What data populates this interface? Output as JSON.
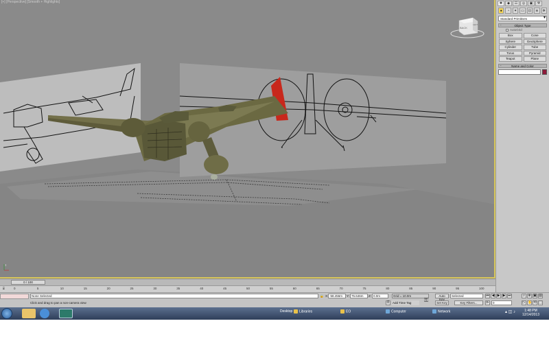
{
  "viewport": {
    "label": "[+] [Perspective] [Smooth + Highlights]",
    "viewcube_front": "BACK",
    "viewcube_side": "LEFT",
    "axis_label": "x"
  },
  "command_panel": {
    "tabs": [
      "create",
      "modify",
      "hierarchy",
      "motion",
      "display",
      "utilities"
    ],
    "category_icons": [
      "geometry",
      "shapes",
      "lights",
      "cameras",
      "helpers",
      "space-warps",
      "systems"
    ],
    "primitive_type": "Standard Primitives",
    "object_type_header": "Object Type",
    "autogrid_label": "AutoGrid",
    "buttons": [
      "Box",
      "Cone",
      "Sphere",
      "GeoSphere",
      "Cylinder",
      "Tube",
      "Torus",
      "Pyramid",
      "Teapot",
      "Plane"
    ],
    "name_color_header": "Name and Color",
    "name_value": "",
    "color": "#8e1a3a"
  },
  "timeline": {
    "slider_label": "0 / 100",
    "ticks": [
      "0",
      "5",
      "10",
      "15",
      "20",
      "25",
      "30",
      "35",
      "40",
      "45",
      "50",
      "55",
      "60",
      "65",
      "70",
      "75",
      "80",
      "85",
      "90",
      "95",
      "100"
    ]
  },
  "status": {
    "selection": "None Selected",
    "prompt": "Click and drag to pan a non-camera view",
    "x_label": "X:",
    "x_value": "-58.456m",
    "y_label": "Y:",
    "y_value": "75.646m",
    "z_label": "Z:",
    "z_value": "0.0m",
    "grid": "Grid = 10.0m",
    "add_time_tag": "Add Time Tag",
    "auto_key": "Auto Key",
    "set_key": "Set Key",
    "selected_dropdown": "Selected",
    "key_filters": "Key Filters...",
    "frame": "0"
  },
  "taskbar": {
    "desktop_label": "Desktop",
    "items": [
      {
        "label": "Libraries",
        "color": "#e8c14a"
      },
      {
        "label": "EO",
        "color": "#e8c14a"
      },
      {
        "label": "Computer",
        "color": "#6fa7d8"
      },
      {
        "label": "Network",
        "color": "#6fa7d8"
      }
    ],
    "time": "1:48 PM",
    "date": "12/14/2013"
  }
}
